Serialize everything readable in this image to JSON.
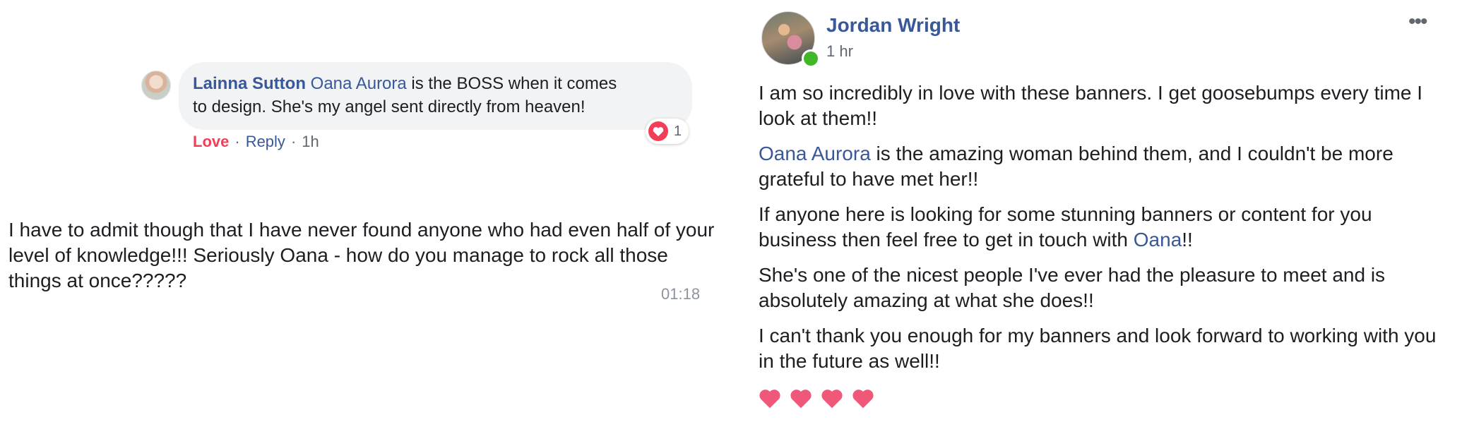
{
  "comment": {
    "author": "Lainna Sutton",
    "tag": "Oana Aurora",
    "text_line1": " is the BOSS when it comes",
    "text_line2": "to design. She's my angel sent directly from heaven!",
    "reaction_count": "1",
    "action_love": "Love",
    "action_reply": "Reply",
    "time": "1h",
    "separator": "·"
  },
  "message": {
    "text": "I have to admit though that I have never found anyone who had even half of your level of knowledge!!! Seriously Oana - how do you manage to rock all those things at once?????",
    "time": "01:18"
  },
  "post": {
    "author": "Jordan Wright",
    "time": "1 hr",
    "more": "•••",
    "p1": "I am so incredibly in love with these banners. I get goosebumps every time I look at them!!",
    "p2_mention": "Oana Aurora",
    "p2_rest": " is the amazing woman behind them, and I couldn't be more grateful to have met her!!",
    "p3_start": "If anyone here is looking for some stunning banners or content for you business then feel free to get in touch with ",
    "p3_mention": "Oana",
    "p3_end": "!!",
    "p4": "She's one of the nicest people I've ever had the pleasure to meet and is absolutely amazing at what she does!!",
    "p5": "I can't thank you enough for my banners and look forward to working with you in the future as well!!",
    "heart_icons": [
      "heart-icon",
      "heart-icon",
      "heart-icon",
      "heart-icon"
    ]
  },
  "colors": {
    "link": "#385898",
    "love": "#f33e58",
    "online": "#42b72a",
    "muted": "#606770"
  }
}
